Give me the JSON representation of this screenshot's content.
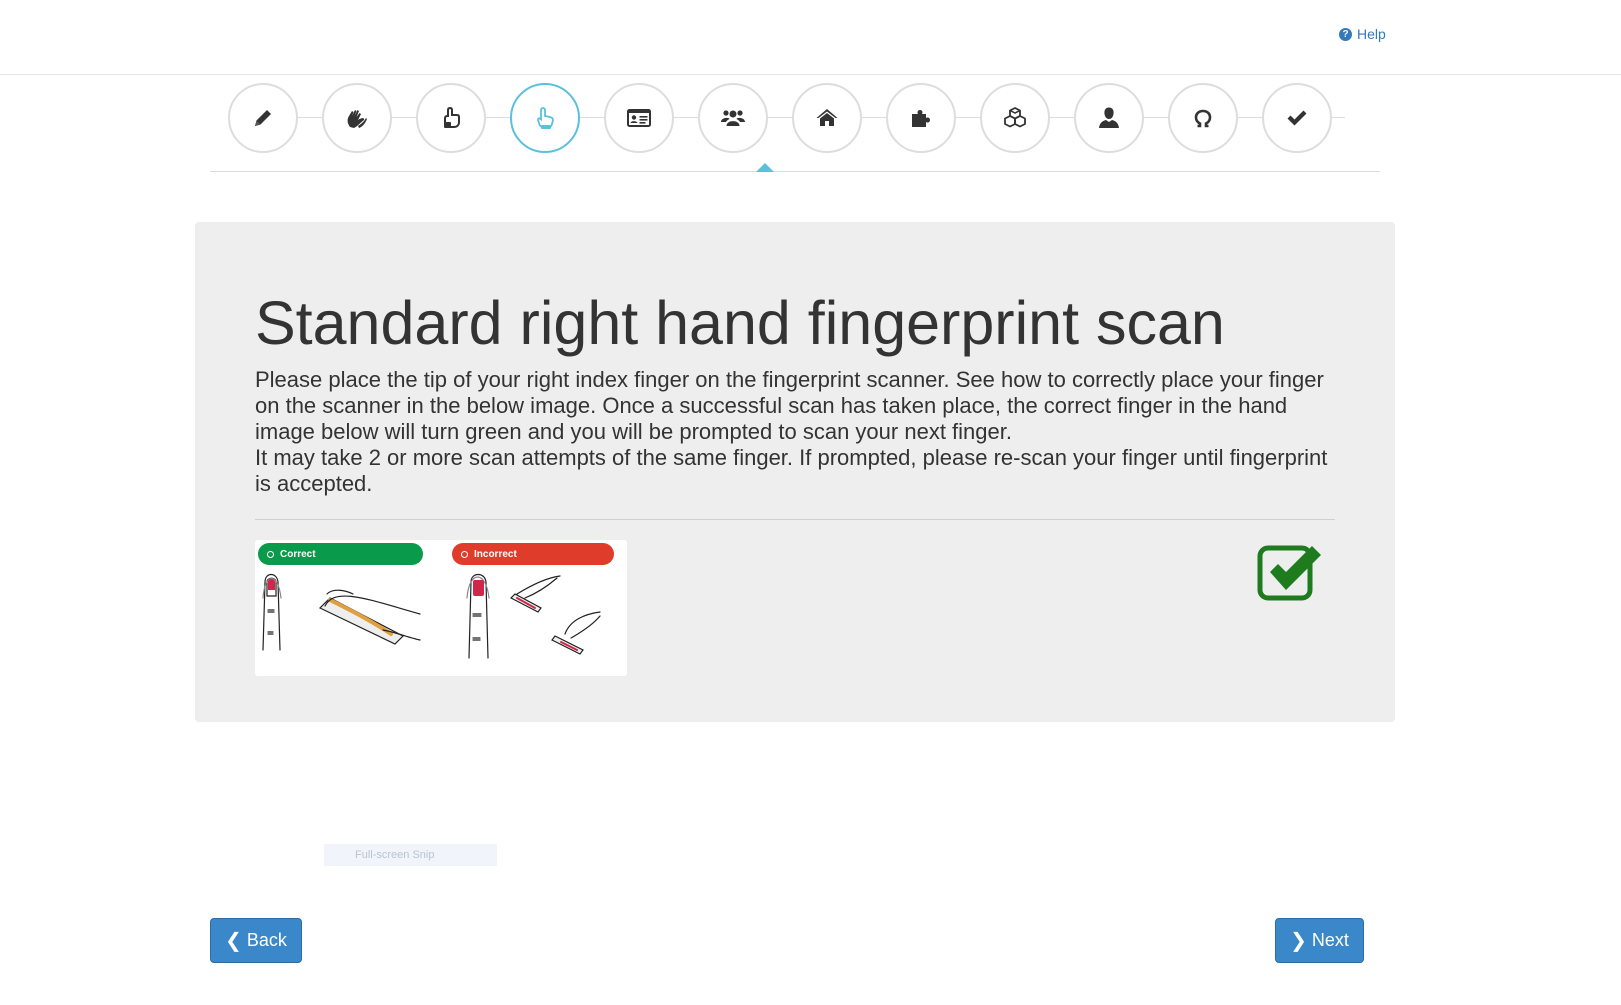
{
  "header": {
    "help_label": "Help",
    "help_icon": "question-circle-icon"
  },
  "steps": [
    {
      "name": "pencil-icon",
      "active": false
    },
    {
      "name": "hands-icon",
      "active": false
    },
    {
      "name": "thumb-hand-icon",
      "active": false
    },
    {
      "name": "index-finger-icon",
      "active": true
    },
    {
      "name": "id-card-icon",
      "active": false
    },
    {
      "name": "group-icon",
      "active": false
    },
    {
      "name": "home-icon",
      "active": false
    },
    {
      "name": "puzzle-icon",
      "active": false
    },
    {
      "name": "cubes-icon",
      "active": false
    },
    {
      "name": "user-icon",
      "active": false
    },
    {
      "name": "omega-icon",
      "active": false
    },
    {
      "name": "check-icon",
      "active": false
    }
  ],
  "main": {
    "title": "Standard right hand fingerprint scan",
    "paragraph1": "Please place the tip of your right index finger on the fingerprint scanner. See how to correctly place your finger on the scanner in the below image. Once a successful scan has taken place, the correct finger in the hand image below will turn green and you will be prompted to scan your next finger.",
    "paragraph2": "It may take 2 or more scan attempts of the same finger. If prompted, please re-scan your finger until fingerprint is accepted.",
    "guide": {
      "correct_label": "Correct",
      "incorrect_label": "Incorrect"
    },
    "status_icon": "checkbox-checked-icon",
    "status_color": "#1e7b1e"
  },
  "footer": {
    "back_label": "Back",
    "next_label": "Next",
    "accent": "#3a87c9"
  },
  "overlay": {
    "snip_label": "Full-screen Snip"
  }
}
